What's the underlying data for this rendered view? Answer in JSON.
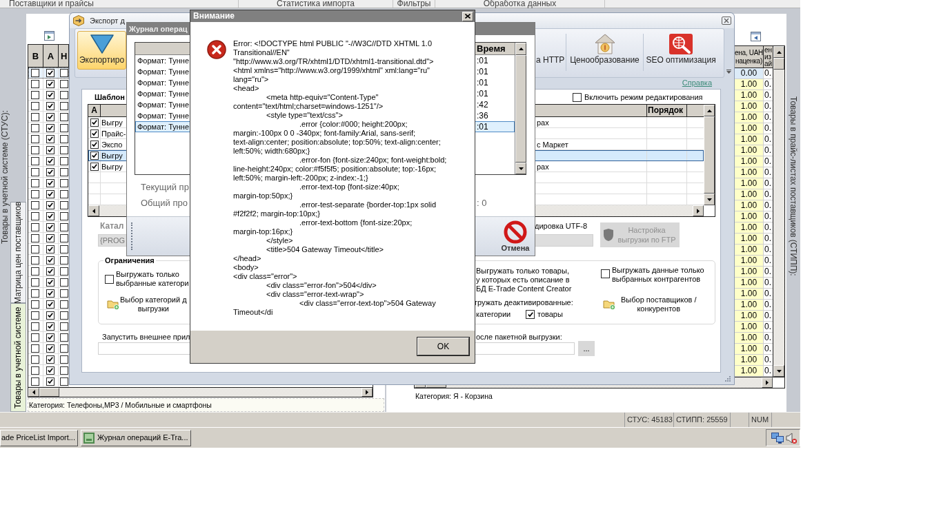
{
  "main_window": {
    "menu_tabs": [
      "Поставщики и прайсы",
      "Статистика импорта",
      "Фильтры",
      "Обработка данных"
    ],
    "stus_panel": {
      "side_label": "Товары в учетной системе (СТУС):",
      "tabs": [
        {
          "label": "Матрица цен поставщиков",
          "selected": false
        },
        {
          "label": "Товары в учетной системе",
          "selected": true
        }
      ],
      "columns": [
        "В",
        "А",
        "Н"
      ],
      "rows": [
        {
          "selected": true,
          "checked": [
            false,
            true,
            false
          ]
        },
        {
          "selected": false,
          "checked": [
            false,
            true,
            false
          ]
        },
        {
          "selected": false,
          "checked": [
            false,
            true,
            false
          ]
        },
        {
          "selected": false,
          "checked": [
            false,
            true,
            false
          ]
        },
        {
          "selected": false,
          "checked": [
            false,
            true,
            false
          ]
        },
        {
          "selected": false,
          "checked": [
            false,
            true,
            false
          ]
        },
        {
          "selected": false,
          "checked": [
            false,
            true,
            false
          ]
        },
        {
          "selected": false,
          "checked": [
            false,
            true,
            false
          ]
        },
        {
          "selected": false,
          "checked": [
            false,
            true,
            false
          ]
        },
        {
          "selected": false,
          "checked": [
            false,
            true,
            false
          ]
        },
        {
          "selected": false,
          "checked": [
            false,
            true,
            false
          ]
        },
        {
          "selected": false,
          "checked": [
            false,
            true,
            false
          ]
        },
        {
          "selected": false,
          "checked": [
            false,
            true,
            false
          ]
        },
        {
          "selected": false,
          "checked": [
            false,
            true,
            false
          ]
        },
        {
          "selected": false,
          "checked": [
            false,
            true,
            false
          ]
        },
        {
          "selected": false,
          "checked": [
            false,
            true,
            false
          ]
        },
        {
          "selected": false,
          "checked": [
            false,
            true,
            false
          ]
        },
        {
          "selected": false,
          "checked": [
            false,
            true,
            false
          ]
        },
        {
          "selected": false,
          "checked": [
            false,
            true,
            false
          ]
        },
        {
          "selected": false,
          "checked": [
            false,
            true,
            false
          ]
        },
        {
          "selected": false,
          "checked": [
            false,
            true,
            false
          ]
        },
        {
          "selected": false,
          "checked": [
            false,
            true,
            false
          ]
        },
        {
          "selected": false,
          "checked": [
            false,
            true,
            false
          ]
        },
        {
          "selected": false,
          "checked": [
            false,
            true,
            false
          ]
        },
        {
          "selected": false,
          "checked": [
            false,
            true,
            false
          ]
        },
        {
          "selected": false,
          "checked": [
            false,
            true,
            false
          ]
        },
        {
          "selected": false,
          "checked": [
            false,
            true,
            false
          ]
        },
        {
          "selected": false,
          "checked": [
            false,
            true,
            false
          ]
        },
        {
          "selected": false,
          "checked": [
            false,
            true,
            false
          ]
        }
      ],
      "category": "Категория: Телефоны,MP3 / Мобильные и смартфоны"
    },
    "stipp_panel": {
      "side_label": "Товары в прайс-листах поставщиков (СТИПП):",
      "columns": [
        "ена, UAH\nнаценка)",
        "ен\nиз\nай"
      ],
      "rows": [
        {
          "selected": true,
          "cells": [
            "0.00",
            "0."
          ]
        },
        {
          "selected": false,
          "cells": [
            "1.00",
            "0."
          ]
        },
        {
          "selected": false,
          "cells": [
            "1.00",
            "0."
          ]
        },
        {
          "selected": false,
          "cells": [
            "1.00",
            "0."
          ]
        },
        {
          "selected": false,
          "cells": [
            "1.00",
            "0."
          ]
        },
        {
          "selected": false,
          "cells": [
            "1.00",
            "0."
          ]
        },
        {
          "selected": false,
          "cells": [
            "1.00",
            "0."
          ]
        },
        {
          "selected": false,
          "cells": [
            "1.00",
            "0."
          ]
        },
        {
          "selected": false,
          "cells": [
            "1.00",
            "0."
          ]
        },
        {
          "selected": false,
          "cells": [
            "1.00",
            "0."
          ]
        },
        {
          "selected": false,
          "cells": [
            "1.00",
            "0."
          ]
        },
        {
          "selected": false,
          "cells": [
            "1.00",
            "0."
          ]
        },
        {
          "selected": false,
          "cells": [
            "1.00",
            "0."
          ]
        },
        {
          "selected": false,
          "cells": [
            "1.00",
            "0."
          ]
        },
        {
          "selected": false,
          "cells": [
            "1.00",
            "0."
          ]
        },
        {
          "selected": false,
          "cells": [
            "1.00",
            "0."
          ]
        },
        {
          "selected": false,
          "cells": [
            "1.00",
            "0."
          ]
        },
        {
          "selected": false,
          "cells": [
            "1.00",
            "0."
          ]
        },
        {
          "selected": false,
          "cells": [
            "1.00",
            "0."
          ]
        },
        {
          "selected": false,
          "cells": [
            "1.00",
            "0."
          ]
        },
        {
          "selected": false,
          "cells": [
            "1.00",
            "0."
          ]
        },
        {
          "selected": false,
          "cells": [
            "1.00",
            "0."
          ]
        },
        {
          "selected": false,
          "cells": [
            "1.00",
            "0."
          ]
        },
        {
          "selected": false,
          "cells": [
            "1.00",
            "0."
          ]
        },
        {
          "selected": false,
          "cells": [
            "1.00",
            "0."
          ]
        },
        {
          "selected": false,
          "cells": [
            "1.00",
            "0."
          ]
        },
        {
          "selected": false,
          "cells": [
            "1.00",
            "0."
          ]
        },
        {
          "selected": false,
          "cells": [
            "1.00",
            "0."
          ]
        }
      ],
      "category": "Категория: Я - Корзина"
    },
    "status_bar": [
      "СТУС: 45183",
      "СТИПП: 25559",
      "NUM"
    ]
  },
  "export_window": {
    "title": "Экспорт д",
    "ribbon": [
      {
        "kind": "export",
        "label": "Экспортиро",
        "selected": true
      },
      {
        "kind": "http",
        "label": "а HTTP",
        "selected": false
      },
      {
        "kind": "pricing",
        "label": "Ценообразование",
        "selected": false
      },
      {
        "kind": "seo",
        "label": "SEO оптимизация",
        "selected": false
      }
    ],
    "help_link": "Справка",
    "templates": {
      "title": "Шаблон",
      "edit_mode": {
        "label": "Включить режим редактирования",
        "checked": false
      },
      "columns": [
        "А",
        "Порядок"
      ],
      "rows": [
        {
          "checked": true,
          "name": "Выгру",
          "tail": "рах",
          "selected": false
        },
        {
          "checked": true,
          "name": "Прайс-",
          "selected": false
        },
        {
          "checked": true,
          "name": "Экспо",
          "tail": "с Маркет",
          "selected": false
        },
        {
          "checked": true,
          "name": "Выгру",
          "selected": true
        },
        {
          "checked": true,
          "name": "Выгру",
          "tail": "рах",
          "selected": false
        }
      ]
    },
    "catalog": {
      "label": "Катал",
      "value": "{PROG"
    },
    "encoding_label": "дировка UTF-8",
    "ftp_button": {
      "label": "Настройка\nвыгрузки по FTP",
      "disabled": true
    },
    "restrictions": {
      "title": "Ограничения",
      "only_selected_categories": {
        "label": "Выгружать только\nвыбранные категори",
        "checked": false
      },
      "choose_categories": "Выбор категорий д\nвыгрузки",
      "only_described": "Выгружать только товары,\nу которых есть описание в\nБД E-Trade Content Creator",
      "deactivated_label": "гружать деактивированные:",
      "deactivated_categories": "категории",
      "deactivated_goods": {
        "label": "товары",
        "checked": true
      },
      "only_selected_contractors": {
        "label": "Выгружать данные только\nвыбранных контрагентов",
        "checked": false
      },
      "choose_suppliers": "Выбор поставщиков /\nконкурентов"
    },
    "run_app": {
      "label": "Запустить внешнее прил",
      "label_tail": "осле пакетной выгрузки:",
      "browse_button": "..."
    }
  },
  "log_window": {
    "title": "Журнал операц",
    "columns": [
      "Время"
    ],
    "rows": [
      {
        "text": "Формат: Тунне",
        "time": ":01",
        "selected": false
      },
      {
        "text": "Формат: Тунне",
        "time": ":01",
        "selected": false
      },
      {
        "text": "Формат: Тунне",
        "time": ":01",
        "selected": false
      },
      {
        "text": "Формат: Тунне",
        "time": ":01",
        "selected": false
      },
      {
        "text": "Формат: Тунне",
        "time": ":42",
        "selected": false
      },
      {
        "text": "Формат: Тунне",
        "time": ":36",
        "selected": false
      },
      {
        "text": "Формат: Тунне",
        "time": ":01",
        "selected": true
      }
    ],
    "current_progress": "Текущий пр",
    "total_progress": "Общий про",
    "total_value": ": 0",
    "cancel_button": "Отмена"
  },
  "alert_dialog": {
    "title": "Внимание",
    "message": "Error: <!DOCTYPE html PUBLIC \"-//W3C//DTD XHTML 1.0\nTransitional//EN\"\n\"http://www.w3.org/TR/xhtml1/DTD/xhtml1-transitional.dtd\">\n<html xmlns=\"http://www.w3.org/1999/xhtml\" xml:lang=\"ru\"\nlang=\"ru\">\n<head>\n\t<meta http-equiv=\"Content-Type\"\ncontent=\"text/html;charset=windows-1251\"/>\n\t<style type=\"text/css\">\n\t\t.error {color:#000; height:200px;\nmargin:-100px 0 0 -340px; font-family:Arial, sans-serif;\ntext-align:center; position:absolute; top:50%; text-align:center;\nleft:50%; width:680px;}\n\t\t.error-fon {font-size:240px; font-weight:bold;\nline-height:240px; color:#f5f5f5; position:absolute; top:-16px;\nleft:50%; margin-left:-200px; z-index:-1;}\n\t\t.error-text-top {font-size:40px;\nmargin-top:50px;}\n\t\t.error-test-separate {border-top:1px solid\n#f2f2f2; margin-top:10px;}\n\t\t.error-text-bottom {font-size:20px;\nmargin-top:16px;}\n\t</style>\n\t<title>504 Gateway Timeout</title>\n</head>\n<body>\n<div class=\"error\">\n\t<div class=\"error-fon\">504</div>\n\t<div class=\"error-text-wrap\">\n\t\t<div class=\"error-text-top\">504 Gateway\nTimeout</di",
    "ok_button": "OK"
  },
  "taskbar": {
    "buttons": [
      {
        "label": "ade PriceList Import...",
        "icon": false
      },
      {
        "label": "Журнал операций E-Tra...",
        "icon": true
      }
    ]
  }
}
